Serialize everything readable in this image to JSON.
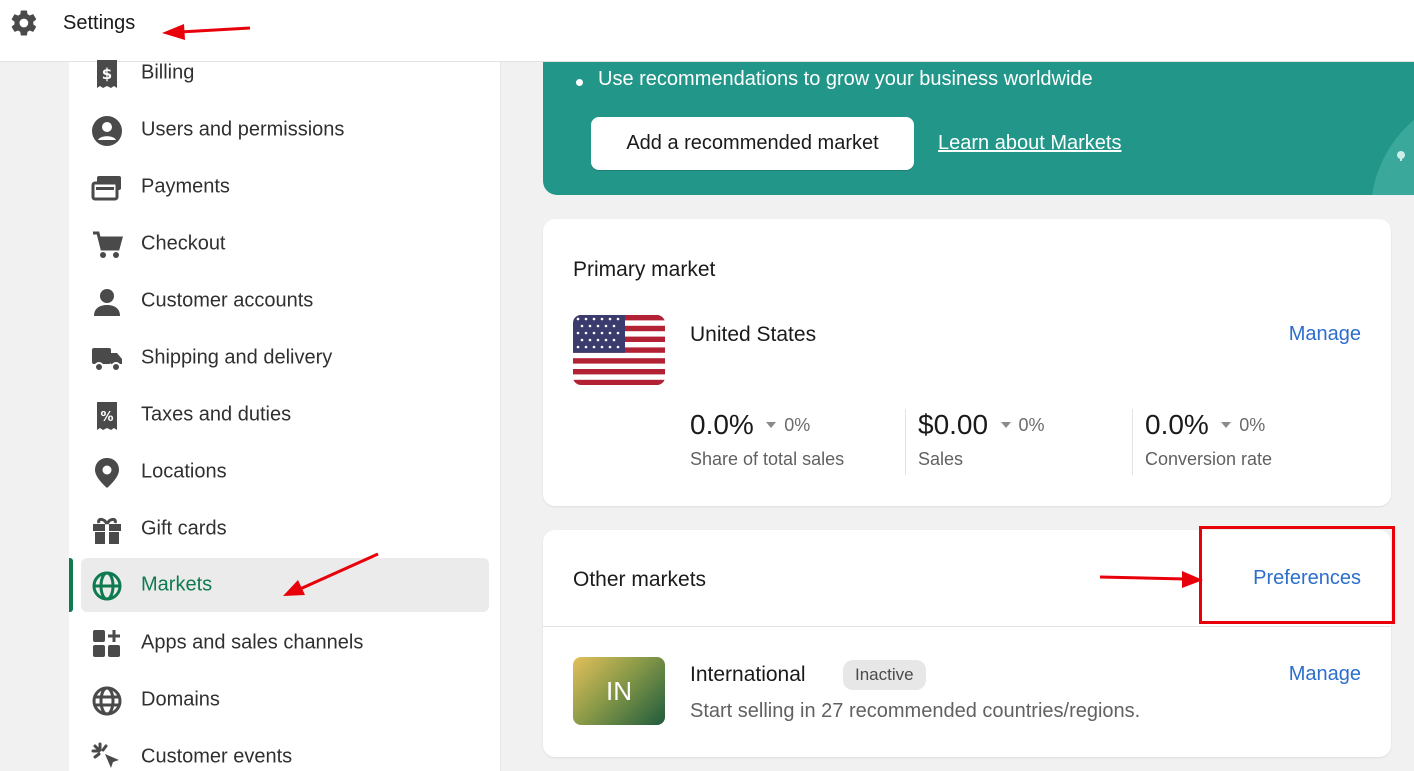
{
  "header": {
    "title": "Settings",
    "icon": "gear-icon"
  },
  "sidebar": {
    "items": [
      {
        "label": "Billing",
        "icon": "billing-icon"
      },
      {
        "label": "Users and permissions",
        "icon": "user-circle-icon"
      },
      {
        "label": "Payments",
        "icon": "payments-icon"
      },
      {
        "label": "Checkout",
        "icon": "cart-icon"
      },
      {
        "label": "Customer accounts",
        "icon": "person-icon"
      },
      {
        "label": "Shipping and delivery",
        "icon": "truck-icon"
      },
      {
        "label": "Taxes and duties",
        "icon": "receipt-percent-icon"
      },
      {
        "label": "Locations",
        "icon": "location-pin-icon"
      },
      {
        "label": "Gift cards",
        "icon": "gift-icon"
      },
      {
        "label": "Markets",
        "icon": "globe-icon",
        "active": true
      },
      {
        "label": "Apps and sales channels",
        "icon": "apps-icon"
      },
      {
        "label": "Domains",
        "icon": "domain-globe-icon"
      },
      {
        "label": "Customer events",
        "icon": "cursor-click-icon"
      }
    ]
  },
  "banner": {
    "bullet": "Use recommendations to grow your business worldwide",
    "button": "Add a recommended market",
    "link": "Learn about Markets"
  },
  "primary_market": {
    "title": "Primary market",
    "name": "United States",
    "manage": "Manage",
    "metrics": [
      {
        "value": "0.0%",
        "delta": "0%",
        "label": "Share of total sales"
      },
      {
        "value": "$0.00",
        "delta": "0%",
        "label": "Sales"
      },
      {
        "value": "0.0%",
        "delta": "0%",
        "label": "Conversion rate"
      }
    ]
  },
  "other_markets": {
    "title": "Other markets",
    "preferences": "Preferences",
    "items": [
      {
        "badge": "IN",
        "name": "International",
        "status": "Inactive",
        "description": "Start selling in 27 recommended countries/regions.",
        "manage": "Manage"
      }
    ]
  },
  "colors": {
    "accent_green": "#0f7a4f",
    "banner_teal": "#23968a",
    "link_blue": "#2c6ecb",
    "annotation_red": "#e8000b"
  }
}
